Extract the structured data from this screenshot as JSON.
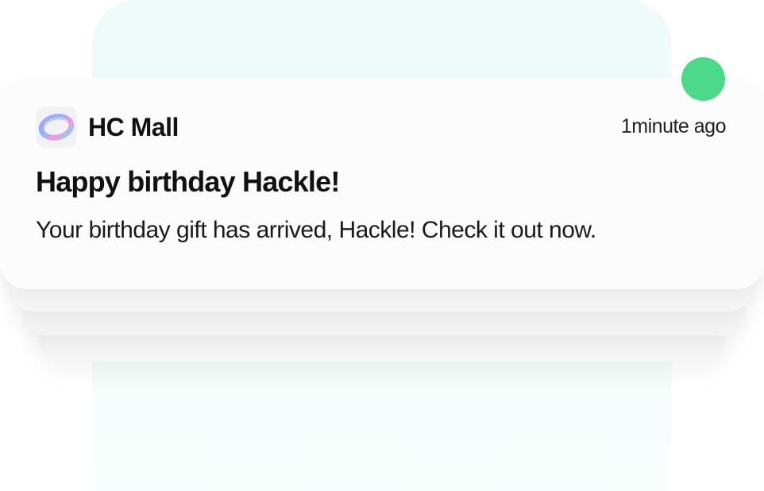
{
  "notification": {
    "app_name": "HC Mall",
    "app_icon": "ring-logo-icon",
    "time": "1minute ago",
    "title": "Happy birthday Hackle!",
    "body": "Your birthday gift has arrived, Hackle! Check it out now."
  },
  "colors": {
    "status_dot": "#4cd98a",
    "phone_background": "#eefbf8",
    "card_background": "#fcfcfc",
    "text_primary": "#111111"
  }
}
